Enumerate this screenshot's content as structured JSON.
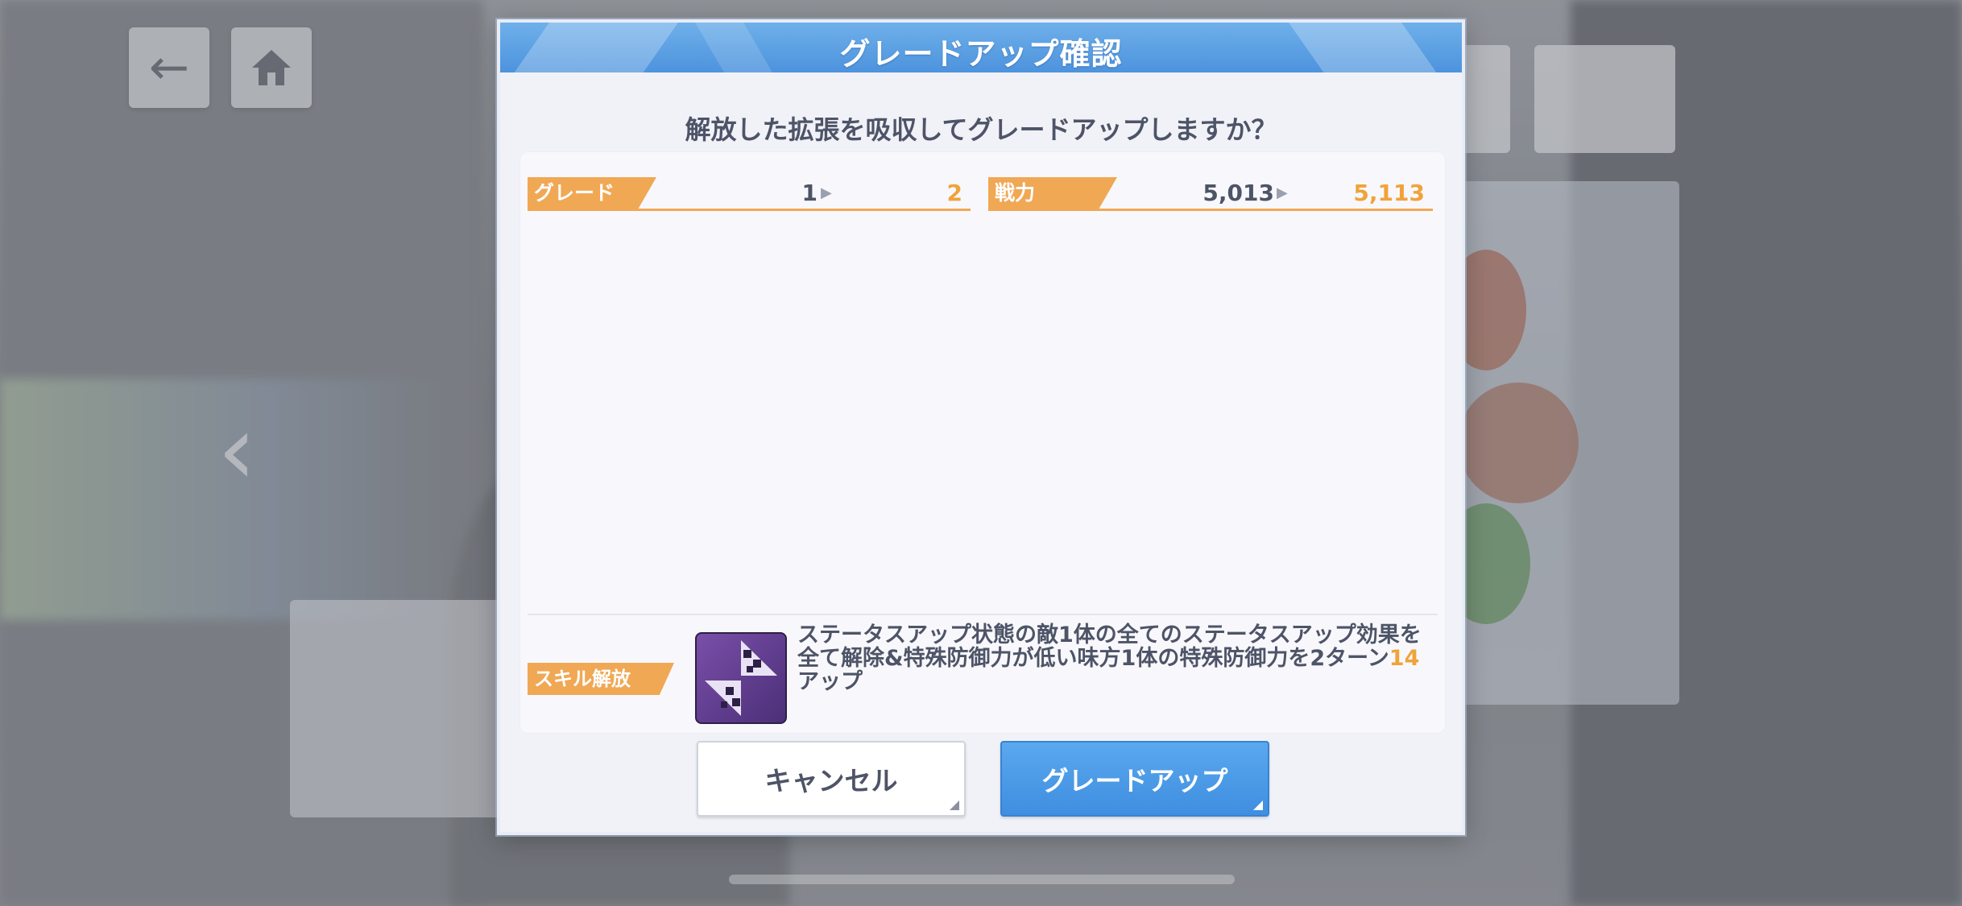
{
  "background": {
    "back_icon": "←",
    "home_icon": "home-icon",
    "left_arrow_icon": "‹"
  },
  "dialog": {
    "title": "グレードアップ確認",
    "question": "解放した拡張を吸収してグレードアップしますか？",
    "grade": {
      "label": "グレード",
      "from": "1",
      "to": "2"
    },
    "power": {
      "label": "戦力",
      "from": "5,013",
      "to": "5,113"
    },
    "skill": {
      "label": "スキル解放",
      "icon": "skill-purple-icon",
      "desc_part1": "ステータスアップ状態の敵1体の全てのステータスアップ効果を全て解除&特殊防御力が低い味方1体の特殊防御力を2ターン",
      "desc_highlight": "14",
      "desc_part2": "アップ"
    },
    "cancel_label": "キャンセル",
    "confirm_label": "グレードアップ"
  },
  "colors": {
    "accent_orange": "#f0a855",
    "value_orange": "#f0a33a",
    "header_blue": "#4d93dd",
    "text": "#4e5467"
  }
}
